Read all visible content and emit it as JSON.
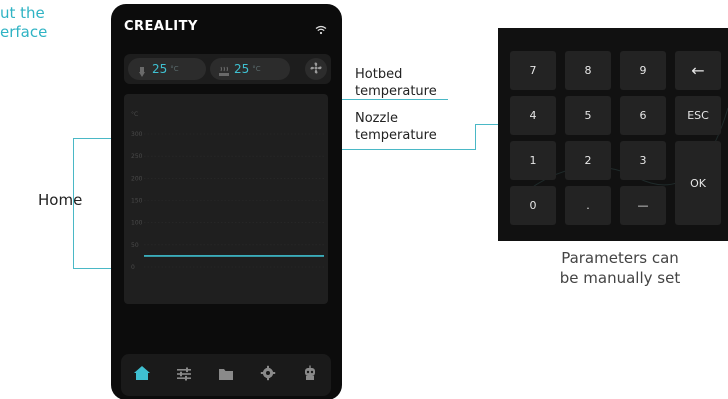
{
  "heading": {
    "line1": "ut the",
    "line2": "erface"
  },
  "callouts": {
    "home": "Home",
    "hotbed_line1": "Hotbed",
    "hotbed_line2": "temperature",
    "nozzle_line1": "Nozzle",
    "nozzle_line2": "temperature",
    "params_line1": "Parameters can",
    "params_line2": "be manually set"
  },
  "screen": {
    "brand": "CREALITY",
    "nozzle_temp": "25",
    "bed_temp": "25",
    "temp_unit": "°C",
    "accent_color": "#3fc0d1",
    "icons": {
      "wifi": "wifi-icon",
      "nozzle": "nozzle-icon",
      "bed": "hotbed-icon",
      "fan": "fan-icon"
    }
  },
  "chart_data": {
    "type": "line",
    "unit_label": "°C",
    "y_ticks": [
      "300",
      "250",
      "200",
      "150",
      "100",
      "50",
      "0"
    ],
    "ylim": [
      0,
      300
    ],
    "series": [
      {
        "values": [
          25,
          25
        ]
      }
    ],
    "grid": true
  },
  "nav": {
    "items": [
      {
        "icon": "home-icon",
        "active": true
      },
      {
        "icon": "sliders-icon",
        "active": false
      },
      {
        "icon": "folder-icon",
        "active": false
      },
      {
        "icon": "gear-icon",
        "active": false
      },
      {
        "icon": "robot-icon",
        "active": false
      }
    ]
  },
  "keypad": {
    "keys": [
      "7",
      "8",
      "9",
      "←",
      "4",
      "5",
      "6",
      "ESC",
      "1",
      "2",
      "3",
      "OK",
      "0",
      ".",
      "—"
    ]
  }
}
